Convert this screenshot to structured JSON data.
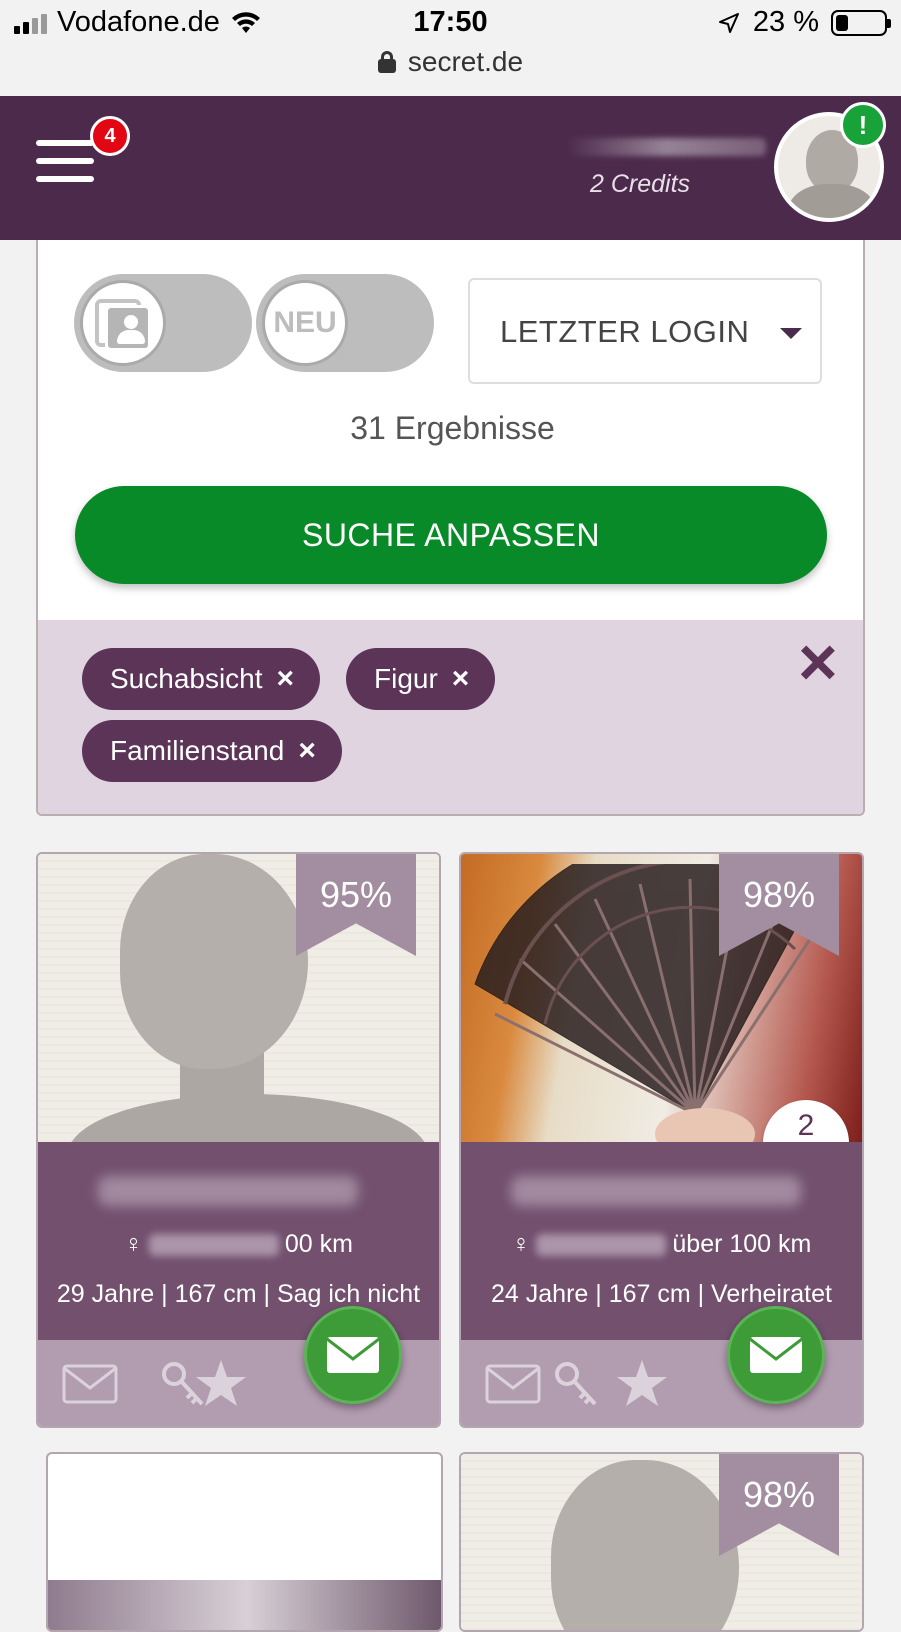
{
  "status_bar": {
    "carrier": "Vodafone.de",
    "time": "17:50",
    "battery": "23 %",
    "battery_level": 0.23,
    "url": "secret.de"
  },
  "header": {
    "menu_badge": "4",
    "credits": "2 Credits",
    "alert": "!"
  },
  "filters": {
    "toggle_new_label": "NEU",
    "sort_label": "LETZTER LOGIN",
    "results": "31 Ergebnisse",
    "adjust_button": "SUCHE ANPASSEN",
    "tags": [
      "Suchabsicht",
      "Figur",
      "Familienstand"
    ],
    "tag_remove_icon": "×",
    "clear_icon": "×"
  },
  "profiles": [
    {
      "match": "95%",
      "distance": "00 km",
      "details": "29 Jahre | 167 cm | Sag ich nicht",
      "gender_icon": "♀"
    },
    {
      "match": "98%",
      "distance": "über 100 km",
      "details": "24 Jahre | 167 cm | Verheiratet",
      "gender_icon": "♀",
      "photo_count": "2"
    },
    {},
    {
      "match": "98%"
    }
  ],
  "icons": {
    "message": "envelope-icon",
    "key": "key-icon",
    "favorite": "star-icon",
    "camera": "camera-icon"
  },
  "colors": {
    "brand_purple": "#4c2a4c",
    "action_green": "#078a27",
    "badge_red": "#e30613",
    "tag_bg": "#e0d4e0"
  }
}
